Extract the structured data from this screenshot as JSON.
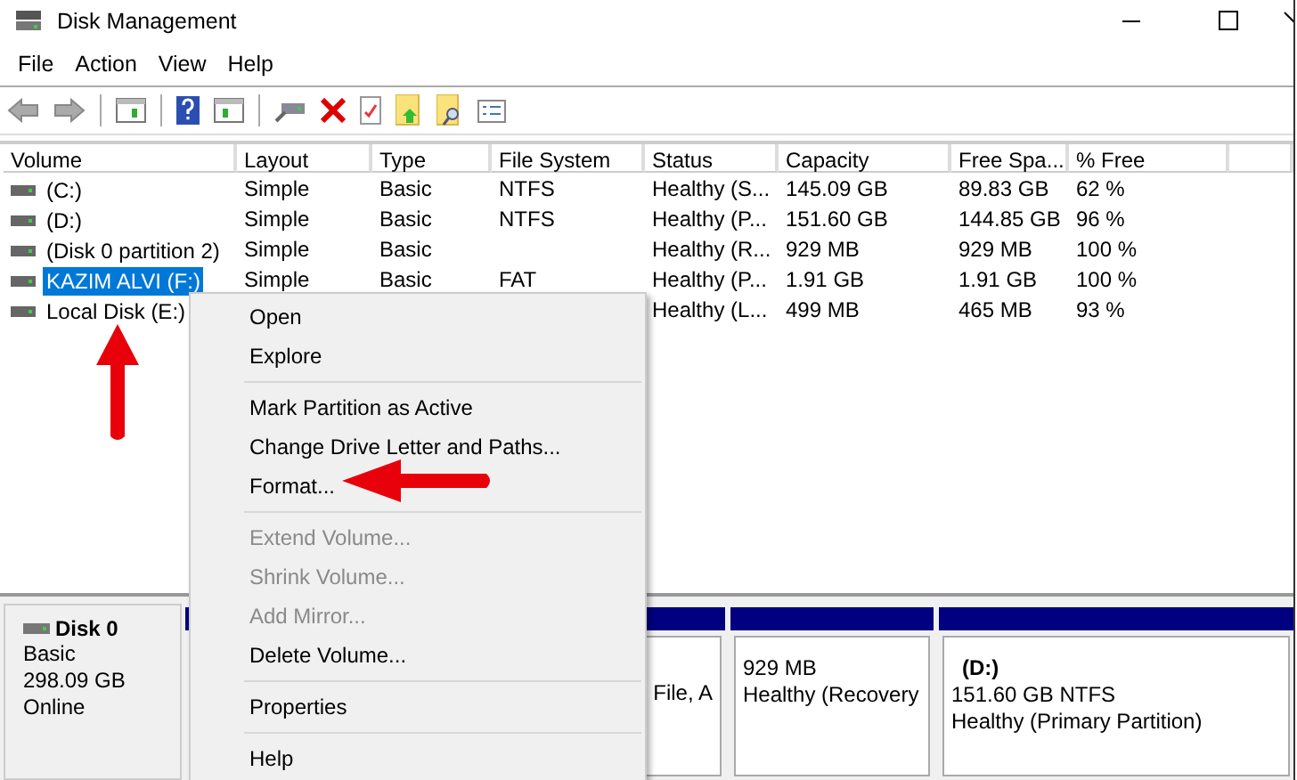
{
  "window": {
    "title": "Disk Management"
  },
  "menu_bar": [
    "File",
    "Action",
    "View",
    "Help"
  ],
  "table": {
    "columns": [
      "Volume",
      "Layout",
      "Type",
      "File System",
      "Status",
      "Capacity",
      "Free Spa...",
      "% Free"
    ],
    "rows": [
      {
        "cells": [
          "(C:)",
          "Simple",
          "Basic",
          "NTFS",
          "Healthy (S...",
          "145.09 GB",
          "89.83 GB",
          "62 %"
        ],
        "selected": false
      },
      {
        "cells": [
          "(D:)",
          "Simple",
          "Basic",
          "NTFS",
          "Healthy (P...",
          "151.60 GB",
          "144.85 GB",
          "96 %"
        ],
        "selected": false
      },
      {
        "cells": [
          "(Disk 0 partition 2)",
          "Simple",
          "Basic",
          null,
          "Healthy (R...",
          "929 MB",
          "929 MB",
          "100 %"
        ],
        "selected": false
      },
      {
        "cells": [
          "KAZIM ALVI (F:)",
          "Simple",
          "Basic",
          "FAT",
          "Healthy (P...",
          "1.91 GB",
          "1.91 GB",
          "100 %"
        ],
        "selected": true
      },
      {
        "cells": [
          "Local Disk (E:)",
          null,
          null,
          null,
          "Healthy (L...",
          "499 MB",
          "465 MB",
          "93 %"
        ],
        "selected": false
      }
    ]
  },
  "disk": {
    "name": "Disk 0",
    "lines": [
      "Basic",
      "298.09 GB",
      "Online"
    ]
  },
  "partitions": [
    {
      "lines": [
        "File, A"
      ]
    },
    {
      "lines": [
        "929 MB",
        "Healthy (Recovery"
      ]
    },
    {
      "title": "(D:)",
      "lines": [
        "151.60 GB NTFS",
        "Healthy (Primary Partition)"
      ]
    }
  ],
  "context_menu": [
    {
      "kind": "item",
      "label": "Open",
      "disabled": false
    },
    {
      "kind": "item",
      "label": "Explore",
      "disabled": false
    },
    {
      "kind": "separator"
    },
    {
      "kind": "item",
      "label": "Mark Partition as Active",
      "disabled": false
    },
    {
      "kind": "item",
      "label": "Change Drive Letter and Paths...",
      "disabled": false
    },
    {
      "kind": "item",
      "label": "Format...",
      "disabled": false
    },
    {
      "kind": "separator"
    },
    {
      "kind": "item",
      "label": "Extend Volume...",
      "disabled": true
    },
    {
      "kind": "item",
      "label": "Shrink Volume...",
      "disabled": true
    },
    {
      "kind": "item",
      "label": "Add Mirror...",
      "disabled": true
    },
    {
      "kind": "item",
      "label": "Delete Volume...",
      "disabled": false
    },
    {
      "kind": "separator"
    },
    {
      "kind": "item",
      "label": "Properties",
      "disabled": false
    },
    {
      "kind": "separator"
    },
    {
      "kind": "item",
      "label": "Help",
      "disabled": false
    }
  ]
}
